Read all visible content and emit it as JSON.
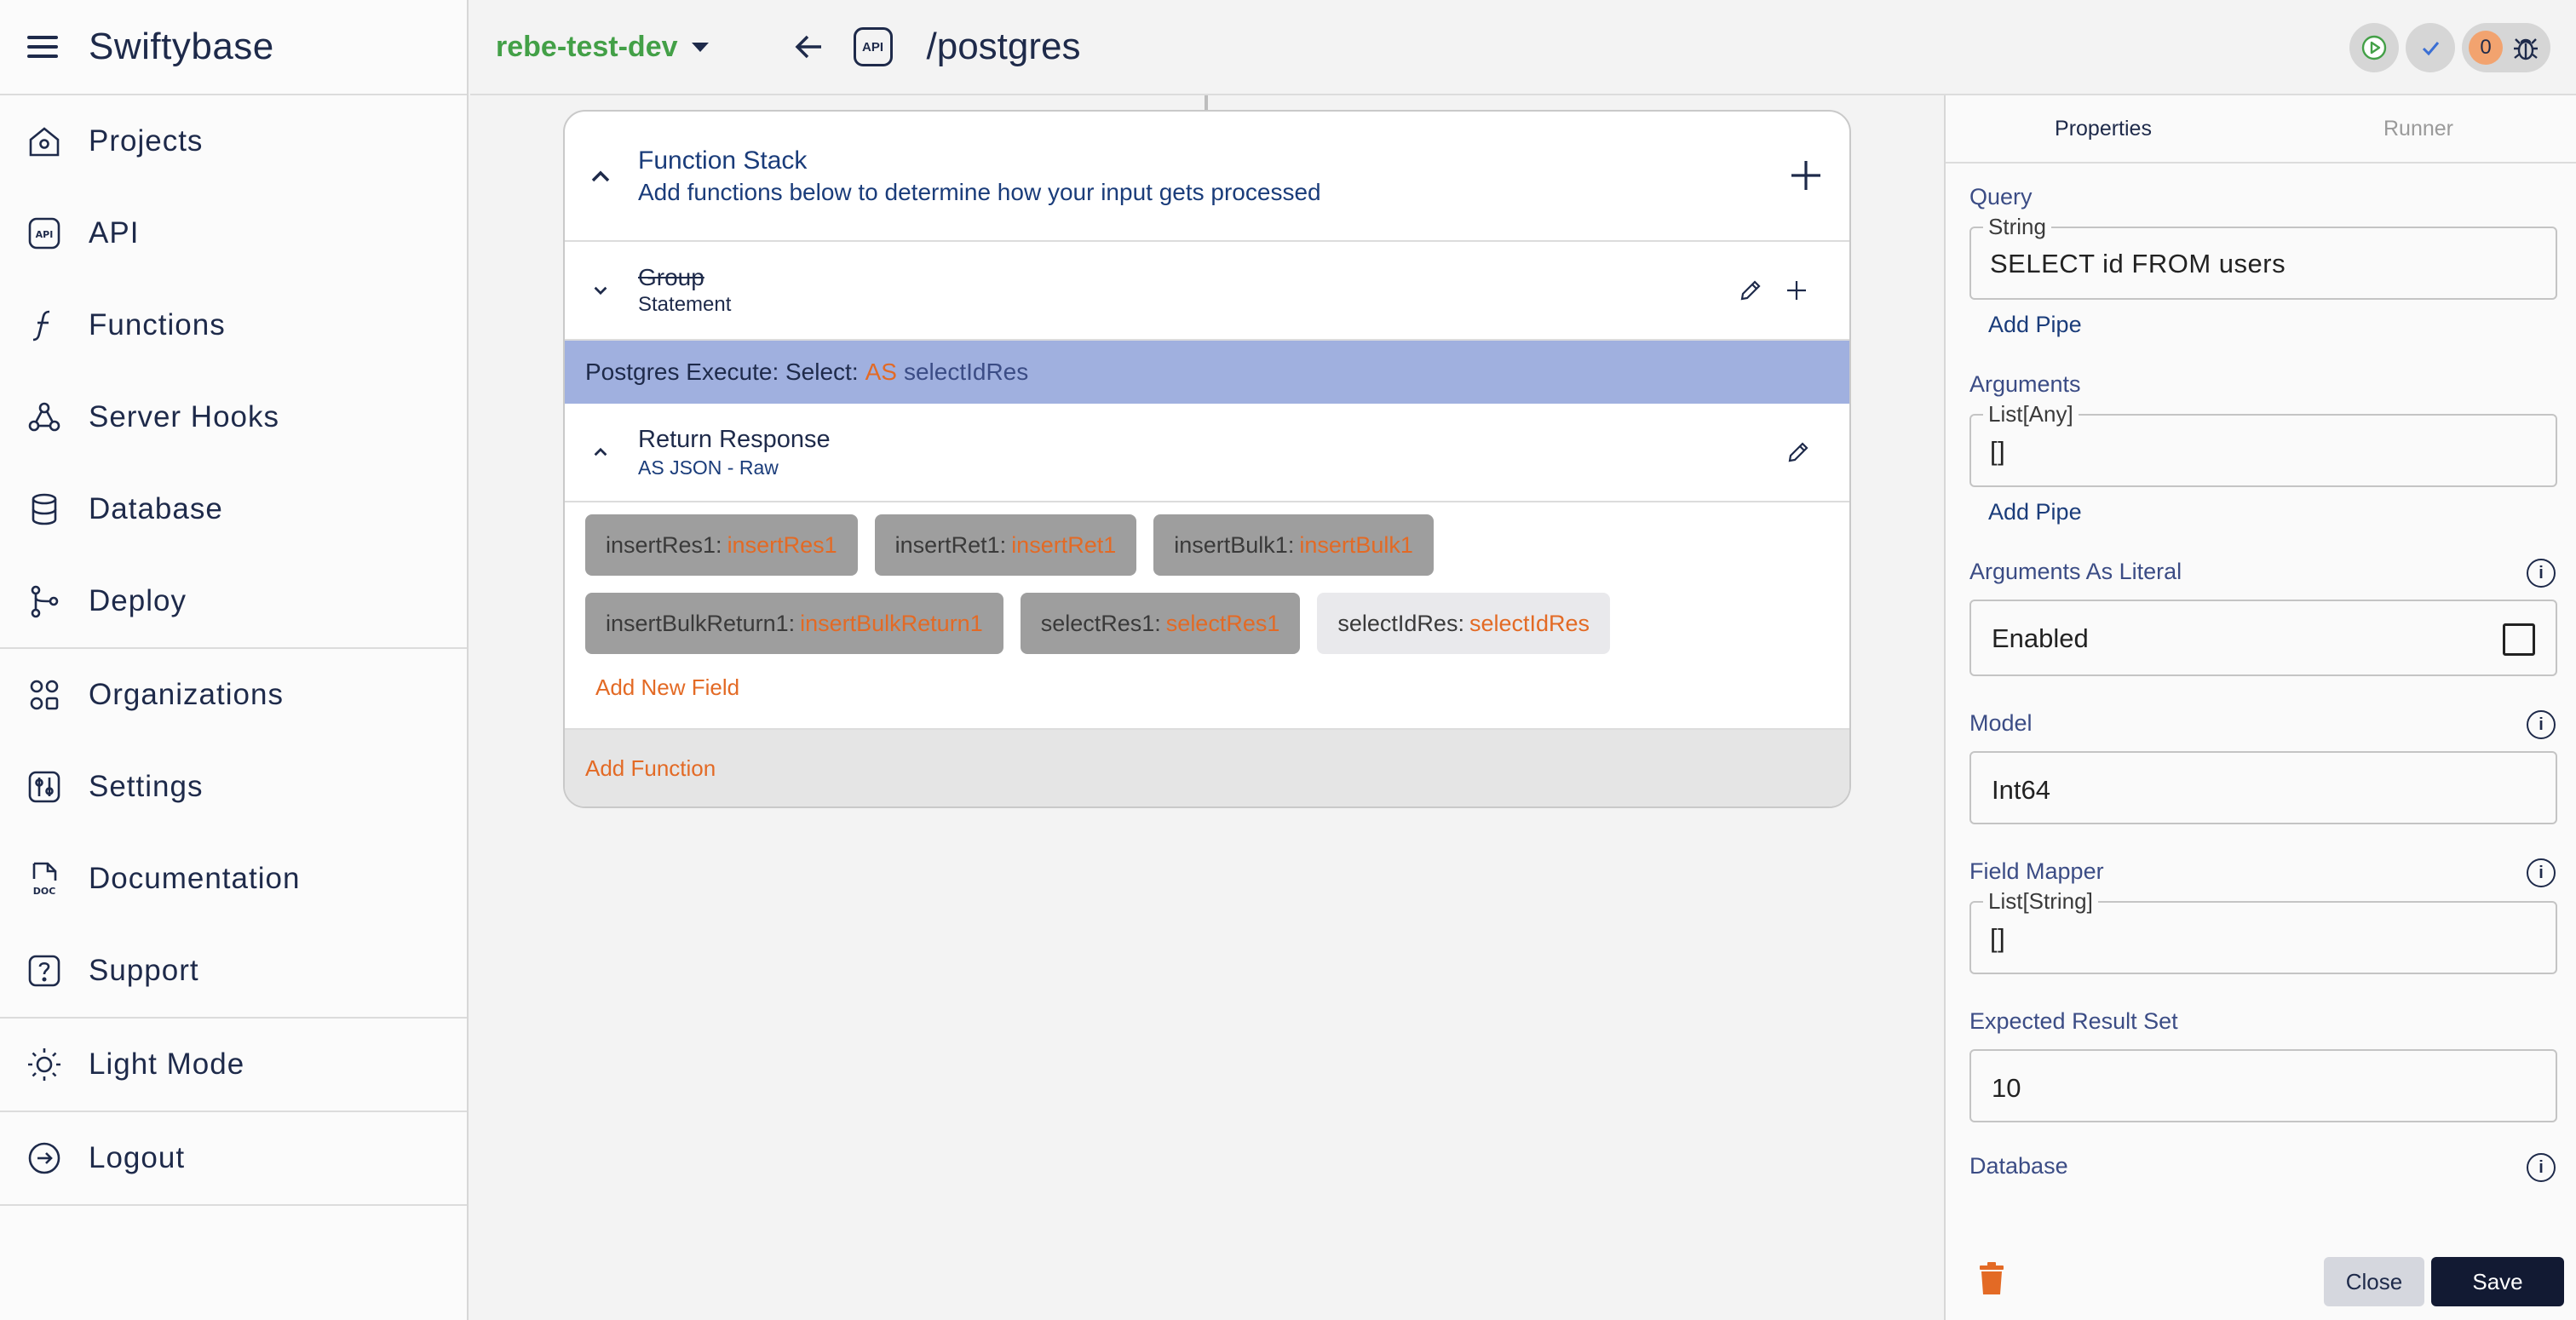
{
  "sidebar": {
    "brand": "Swiftybase",
    "groups": [
      [
        {
          "label": "Projects",
          "icon": "home-icon"
        },
        {
          "label": "API",
          "icon": "api-icon"
        },
        {
          "label": "Functions",
          "icon": "function-icon"
        },
        {
          "label": "Server Hooks",
          "icon": "webhook-icon"
        },
        {
          "label": "Database",
          "icon": "database-icon"
        },
        {
          "label": "Deploy",
          "icon": "deploy-branch-icon"
        }
      ],
      [
        {
          "label": "Organizations",
          "icon": "organizations-icon"
        },
        {
          "label": "Settings",
          "icon": "settings-icon"
        },
        {
          "label": "Documentation",
          "icon": "documentation-icon"
        },
        {
          "label": "Support",
          "icon": "support-icon"
        }
      ],
      [
        {
          "label": "Light Mode",
          "icon": "sun-icon"
        }
      ],
      [
        {
          "label": "Logout",
          "icon": "logout-icon"
        }
      ]
    ]
  },
  "topbar": {
    "environment": "rebe-test-dev",
    "api_badge": "API",
    "path": "/postgres",
    "error_count": "0",
    "accent": "#43a047"
  },
  "function_stack": {
    "title": "Function Stack",
    "subtitle": "Add functions below to determine how your input gets processed",
    "group": {
      "name": "Group",
      "type": "Statement"
    },
    "execute": {
      "label": "Postgres Execute: Select:",
      "as": "AS",
      "var": "selectIdRes"
    },
    "return": {
      "title": "Return Response",
      "subtitle": "AS JSON - Raw"
    },
    "fields": [
      {
        "key": "insertRes1:",
        "value": "insertRes1",
        "style": "dark"
      },
      {
        "key": "insertRet1:",
        "value": "insertRet1",
        "style": "dark"
      },
      {
        "key": "insertBulk1:",
        "value": "insertBulk1",
        "style": "dark"
      },
      {
        "key": "insertBulkReturn1:",
        "value": "insertBulkReturn1",
        "style": "dark"
      },
      {
        "key": "selectRes1:",
        "value": "selectRes1",
        "style": "dark"
      },
      {
        "key": "selectIdRes:",
        "value": "selectIdRes",
        "style": "light"
      }
    ],
    "add_field": "Add New Field",
    "add_function": "Add Function"
  },
  "panel": {
    "tabs": [
      "Properties",
      "Runner"
    ],
    "query": {
      "label": "Query",
      "legend": "String",
      "value": "SELECT id FROM users",
      "add_pipe": "Add Pipe"
    },
    "arguments": {
      "label": "Arguments",
      "legend": "List[Any]",
      "value": "[]",
      "add_pipe": "Add Pipe"
    },
    "arguments_literal": {
      "label": "Arguments As Literal",
      "value": "Enabled",
      "checked": false
    },
    "model": {
      "label": "Model",
      "value": "Int64"
    },
    "field_mapper": {
      "label": "Field Mapper",
      "legend": "List[String]",
      "value": "[]"
    },
    "expected": {
      "label": "Expected Result Set",
      "value": "10"
    },
    "database": {
      "label": "Database"
    },
    "close": "Close",
    "save": "Save"
  }
}
